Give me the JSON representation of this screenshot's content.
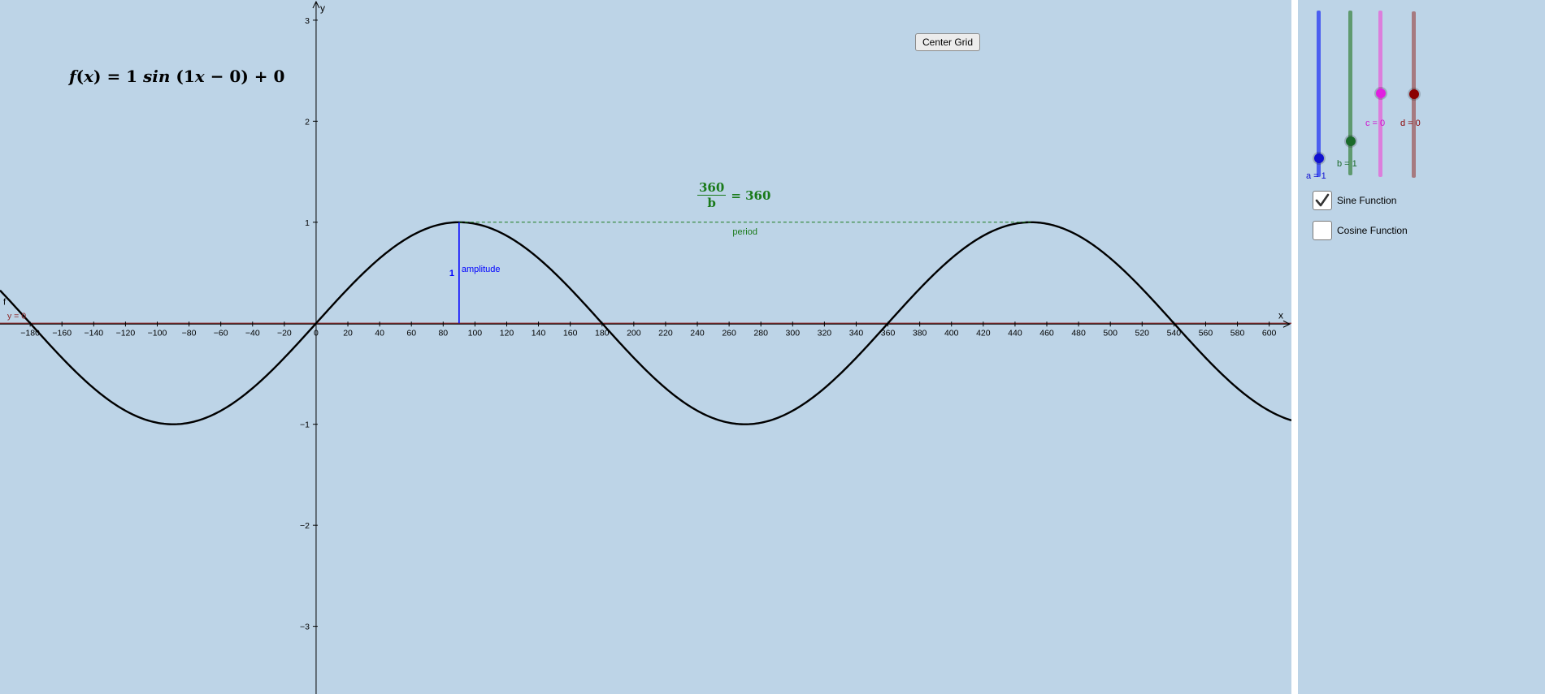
{
  "colors": {
    "background": "#bdd4e7",
    "curve": "#000000",
    "amplitude": "#0000ff",
    "period": "#1a7a1a",
    "y_line": "#8b2020"
  },
  "formula": {
    "prefix": "f",
    "arg": "x",
    "eq": " = 1 ",
    "fn": "sin",
    "body": " (1",
    "var": "x",
    "rest": " − 0) + 0"
  },
  "period_formula": {
    "numerator": "360",
    "denominator": "b",
    "result": "= 360"
  },
  "center_grid_label": "Center Grid",
  "labels": {
    "amplitude_value": "1",
    "amplitude": "amplitude",
    "period": "period",
    "y_line": "y = 0",
    "f": "f",
    "x_axis": "x",
    "y_axis": "y"
  },
  "axes": {
    "x_ticks": [
      "−180",
      "−160",
      "−140",
      "−120",
      "−100",
      "−80",
      "−60",
      "−40",
      "−20",
      "0",
      "20",
      "40",
      "60",
      "80",
      "100",
      "120",
      "140",
      "160",
      "180",
      "200",
      "220",
      "240",
      "260",
      "280",
      "300",
      "320",
      "340",
      "360",
      "380",
      "400",
      "420",
      "440",
      "460",
      "480",
      "500",
      "520",
      "540",
      "560",
      "580",
      "600"
    ],
    "y_ticks": [
      "3",
      "2",
      "1",
      "−1",
      "−2",
      "−3"
    ]
  },
  "chart_data": {
    "type": "line",
    "function": "f(x) = 1 sin(1x − 0) + 0",
    "x_unit": "degrees",
    "xlim": [
      -199,
      614
    ],
    "ylim": [
      -3.67,
      3.2
    ],
    "amplitude": 1,
    "period": 360,
    "marked_peaks": [
      [
        90,
        1
      ],
      [
        450,
        1
      ]
    ]
  },
  "sliders": [
    {
      "name": "a",
      "label": "a = 1",
      "value": 1,
      "color": "#4b5ef0",
      "knob": "#1010d0",
      "text_color": "#1010d0"
    },
    {
      "name": "b",
      "label": "b = 1",
      "value": 1,
      "color": "#5f9a6f",
      "knob": "#1a6a2a",
      "text_color": "#1a6a2a"
    },
    {
      "name": "c",
      "label": "c = 0",
      "value": 0,
      "color": "#dc7edc",
      "knob": "#e020e0",
      "text_color": "#d010d0"
    },
    {
      "name": "d",
      "label": "d = 0",
      "value": 0,
      "color": "#a67a80",
      "knob": "#8b0000",
      "text_color": "#8b0000"
    }
  ],
  "checkboxes": [
    {
      "label": "Sine Function",
      "checked": true
    },
    {
      "label": "Cosine Function",
      "checked": false
    }
  ]
}
